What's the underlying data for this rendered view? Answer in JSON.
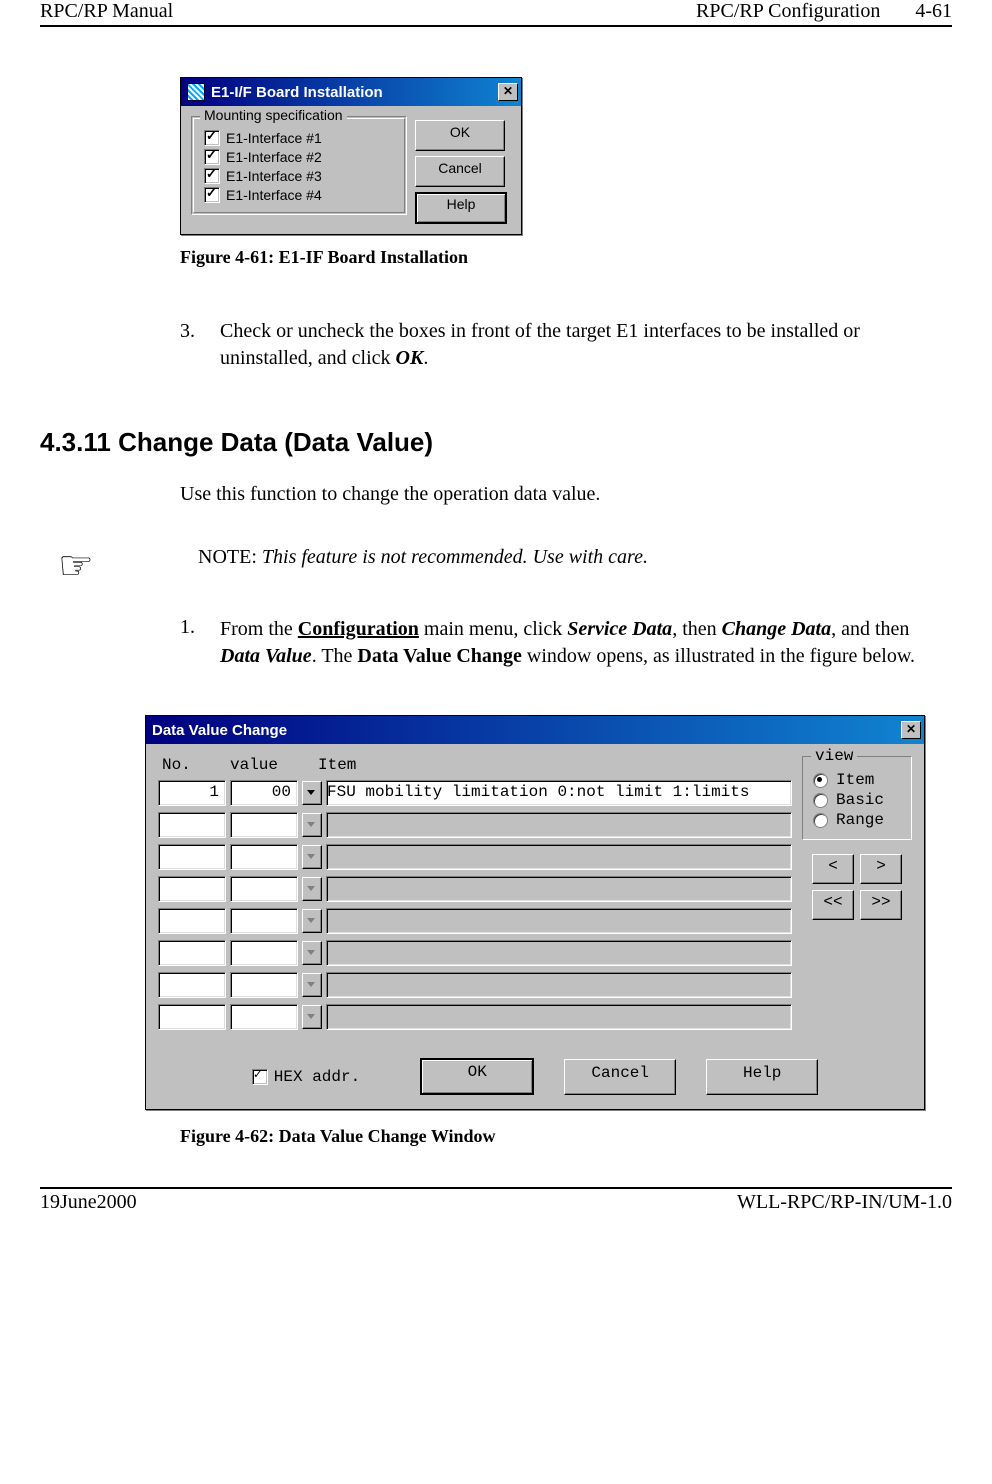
{
  "page": {
    "header_left": "RPC/RP Manual",
    "header_right_label": "RPC/RP Configuration",
    "header_right_page": "4-61",
    "footer_left": "19June2000",
    "footer_right": "WLL-RPC/RP-IN/UM-1.0"
  },
  "dialog1": {
    "title": "E1-I/F Board Installation",
    "group_label": "Mounting specification",
    "checks": [
      {
        "label": "E1-Interface #1",
        "checked": true
      },
      {
        "label": "E1-Interface #2",
        "checked": true
      },
      {
        "label": "E1-Interface #3",
        "checked": true
      },
      {
        "label": "E1-Interface #4",
        "checked": true
      }
    ],
    "buttons": {
      "ok": "OK",
      "cancel": "Cancel",
      "help": "Help"
    },
    "caption": "Figure 4-61: E1-IF Board Installation",
    "close": "✕"
  },
  "step3": {
    "num": "3.",
    "text_a": "Check or uncheck the boxes in front of the target E1 interfaces to be installed or uninstalled, and click ",
    "text_ok": "OK",
    "text_b": "."
  },
  "section": {
    "number_title": "4.3.11 Change Data (Data Value)",
    "intro": "Use this function to change the operation data value."
  },
  "note": {
    "icon": "☞",
    "label": "NOTE: ",
    "text": "This feature is not recommended.  Use with care."
  },
  "step1": {
    "num": "1.",
    "t1": "From the ",
    "config": "Configuration",
    "t2": " main menu, click ",
    "svc": "Service Data",
    "t3": ", then ",
    "chg": "Change Data",
    "t4": ", and then ",
    "dv": "Data Value",
    "t5": ".  The ",
    "dvc": "Data Value Change",
    "t6": " window opens, as illustrated in the figure below."
  },
  "dialog2": {
    "title": "Data Value Change",
    "close": "✕",
    "headers": {
      "no": "No.",
      "value": "value",
      "item": "Item"
    },
    "rows": [
      {
        "no": "1",
        "value": "00",
        "item": "FSU mobility limitation 0:not limit 1:limits",
        "active": true
      },
      {
        "no": "",
        "value": "",
        "item": "",
        "active": false
      },
      {
        "no": "",
        "value": "",
        "item": "",
        "active": false
      },
      {
        "no": "",
        "value": "",
        "item": "",
        "active": false
      },
      {
        "no": "",
        "value": "",
        "item": "",
        "active": false
      },
      {
        "no": "",
        "value": "",
        "item": "",
        "active": false
      },
      {
        "no": "",
        "value": "",
        "item": "",
        "active": false
      },
      {
        "no": "",
        "value": "",
        "item": "",
        "active": false
      }
    ],
    "view": {
      "legend": "view",
      "options": [
        {
          "label": "Item",
          "selected": true
        },
        {
          "label": "Basic",
          "selected": false
        },
        {
          "label": "Range",
          "selected": false
        }
      ]
    },
    "nav": {
      "prev": "<",
      "next": ">",
      "first": "<<",
      "last": ">>"
    },
    "hex_label": "HEX addr.",
    "hex_checked": true,
    "buttons": {
      "ok": "OK",
      "cancel": "Cancel",
      "help": "Help"
    },
    "caption": "Figure 4-62: Data Value Change Window"
  }
}
